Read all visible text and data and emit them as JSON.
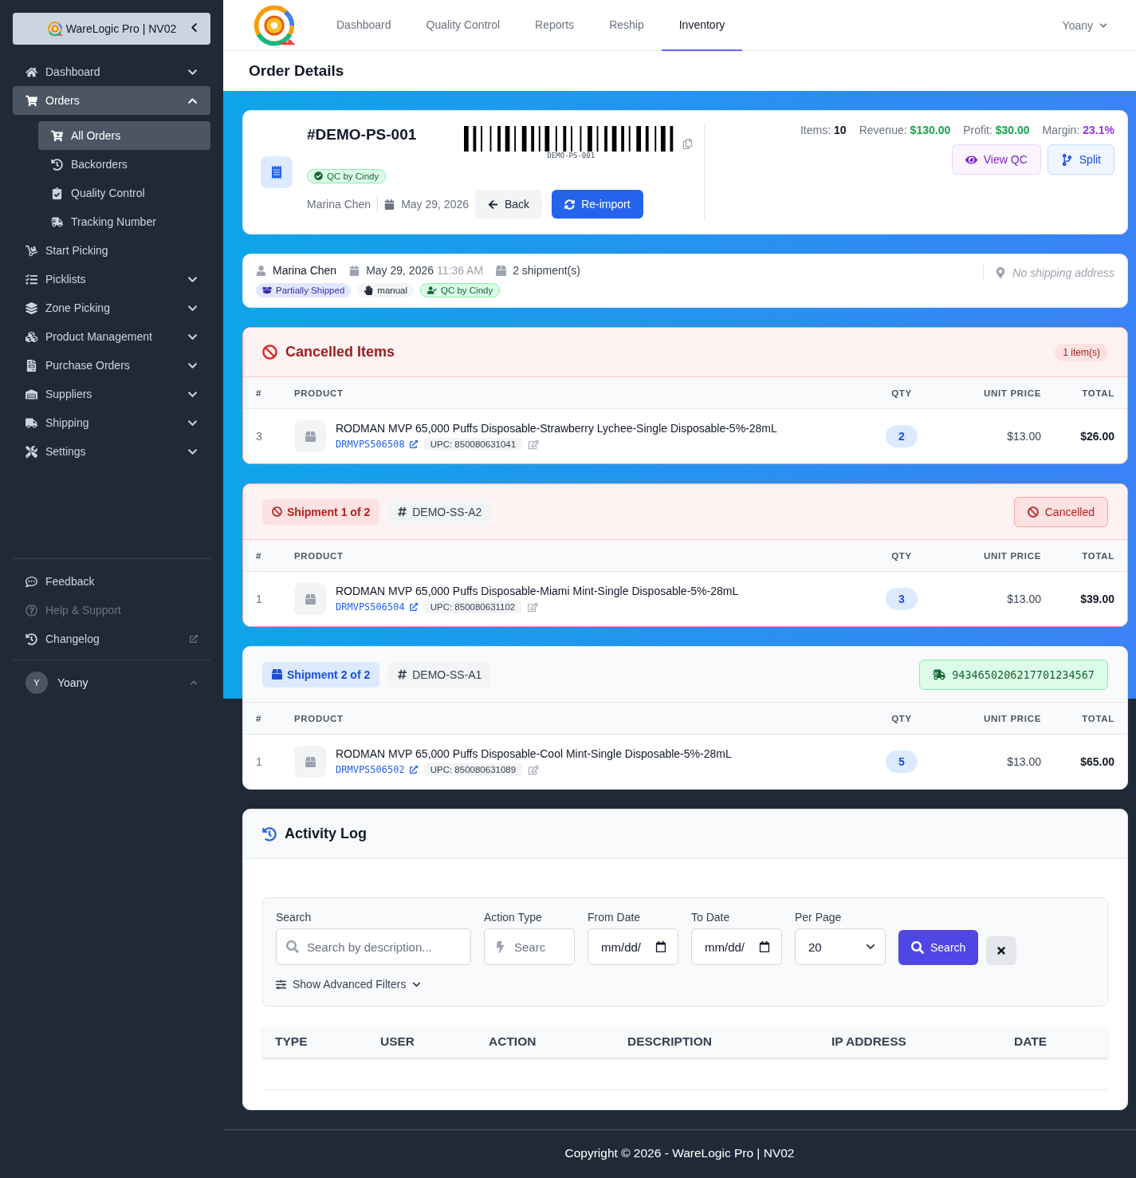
{
  "sidebar": {
    "brand": "WareLogic Pro | NV02",
    "items": [
      {
        "label": "Dashboard",
        "expandable": true,
        "expanded": false,
        "selected": false
      },
      {
        "label": "Orders",
        "expandable": true,
        "expanded": true,
        "selected": true,
        "children": [
          {
            "label": "All Orders",
            "selected": true
          },
          {
            "label": "Backorders",
            "selected": false
          },
          {
            "label": "Quality Control",
            "selected": false
          },
          {
            "label": "Tracking Number",
            "selected": false
          }
        ]
      },
      {
        "label": "Start Picking",
        "expandable": false,
        "expanded": false,
        "selected": false
      },
      {
        "label": "Picklists",
        "expandable": true,
        "expanded": false,
        "selected": false
      },
      {
        "label": "Zone Picking",
        "expandable": true,
        "expanded": false,
        "selected": false
      },
      {
        "label": "Product Management",
        "expandable": true,
        "expanded": false,
        "selected": false
      },
      {
        "label": "Purchase Orders",
        "expandable": true,
        "expanded": false,
        "selected": false
      },
      {
        "label": "Suppliers",
        "expandable": true,
        "expanded": false,
        "selected": false
      },
      {
        "label": "Shipping",
        "expandable": true,
        "expanded": false,
        "selected": false
      },
      {
        "label": "Settings",
        "expandable": true,
        "expanded": false,
        "selected": false
      }
    ],
    "bottom_links": [
      {
        "label": "Feedback",
        "disabled": false,
        "external": false
      },
      {
        "label": "Help & Support",
        "disabled": true,
        "external": false
      },
      {
        "label": "Changelog",
        "disabled": false,
        "external": true
      }
    ],
    "user": {
      "initial": "Y",
      "name": "Yoany"
    }
  },
  "topnav": {
    "tabs": [
      {
        "label": "Dashboard",
        "selected": false
      },
      {
        "label": "Quality Control",
        "selected": false
      },
      {
        "label": "Reports",
        "selected": false
      },
      {
        "label": "Reship",
        "selected": false
      },
      {
        "label": "Inventory",
        "selected": true
      }
    ],
    "user": "Yoany"
  },
  "page_title": "Order Details",
  "order": {
    "number": "#DEMO-PS-001",
    "barcode_text": "DEMO-PS-001",
    "qc_badge": "QC by Cindy",
    "customer": "Marina Chen",
    "date": "May 29, 2026",
    "back": "Back",
    "reimport": "Re-import",
    "stats": [
      {
        "label": "Items:",
        "value": "10",
        "color": "#111827"
      },
      {
        "label": "Revenue:",
        "value": "$130.00",
        "color": "#16a34a"
      },
      {
        "label": "Profit:",
        "value": "$30.00",
        "color": "#16a34a"
      },
      {
        "label": "Margin:",
        "value": "23.1%",
        "color": "#9333ea"
      }
    ],
    "actions": [
      {
        "label": "View QC",
        "kind": "qc"
      },
      {
        "label": "Split",
        "kind": "split"
      }
    ]
  },
  "info": {
    "customer": "Marina Chen",
    "date": "May 29, 2026",
    "time": "11:36 AM",
    "shipments": "2 shipment(s)",
    "address": "No shipping address",
    "tags": [
      {
        "label": "Partially Shipped",
        "kind": "status"
      },
      {
        "label": "manual",
        "kind": "source"
      },
      {
        "label": "QC by Cindy",
        "kind": "qc"
      }
    ]
  },
  "sections": [
    {
      "kind": "cancelled_items",
      "title": "Cancelled Items",
      "count": "1 item(s)",
      "columns": [
        "#",
        "PRODUCT",
        "QTY",
        "UNIT PRICE",
        "TOTAL"
      ],
      "rows": [
        {
          "index": "3",
          "name": "RODMAN MVP 65,000 Puffs Disposable-Strawberry Lychee-Single Disposable-5%-28mL",
          "sku": "DRMVPS506508",
          "upc": "UPC: 850080631041",
          "qty": "2",
          "unit_price": "$13.00",
          "total": "$26.00"
        }
      ]
    },
    {
      "kind": "cancelled_shipment",
      "title": "Shipment 1 of 2",
      "ref": "DEMO-SS-A2",
      "status": "Cancelled",
      "columns": [
        "#",
        "PRODUCT",
        "QTY",
        "UNIT PRICE",
        "TOTAL"
      ],
      "rows": [
        {
          "index": "1",
          "name": "RODMAN MVP 65,000 Puffs Disposable-Miami Mint-Single Disposable-5%-28mL",
          "sku": "DRMVPS506504",
          "upc": "UPC: 850080631102",
          "qty": "3",
          "unit_price": "$13.00",
          "total": "$39.00"
        }
      ]
    },
    {
      "kind": "shipment",
      "title": "Shipment 2 of 2",
      "ref": "DEMO-SS-A1",
      "tracking": "9434650206217701234567",
      "columns": [
        "#",
        "PRODUCT",
        "QTY",
        "UNIT PRICE",
        "TOTAL"
      ],
      "rows": [
        {
          "index": "1",
          "name": "RODMAN MVP 65,000 Puffs Disposable-Cool Mint-Single Disposable-5%-28mL",
          "sku": "DRMVPS506502",
          "upc": "UPC: 850080631089",
          "qty": "5",
          "unit_price": "$13.00",
          "total": "$65.00"
        }
      ]
    }
  ],
  "activity": {
    "title": "Activity Log",
    "filters": [
      {
        "label": "Search",
        "kind": "search",
        "placeholder": "Search by description..."
      },
      {
        "label": "Action Type",
        "kind": "action",
        "placeholder": "Searc"
      },
      {
        "label": "From Date",
        "kind": "date",
        "value": "mm/dd/"
      },
      {
        "label": "To Date",
        "kind": "date",
        "value": "mm/dd/"
      },
      {
        "label": "Per Page",
        "kind": "select",
        "value": "20"
      }
    ],
    "search_button": "Search",
    "advanced": "Show Advanced Filters",
    "columns": [
      "TYPE",
      "USER",
      "ACTION",
      "DESCRIPTION",
      "IP ADDRESS",
      "DATE"
    ]
  },
  "footer": "Copyright © 2026 - WareLogic Pro | NV02"
}
